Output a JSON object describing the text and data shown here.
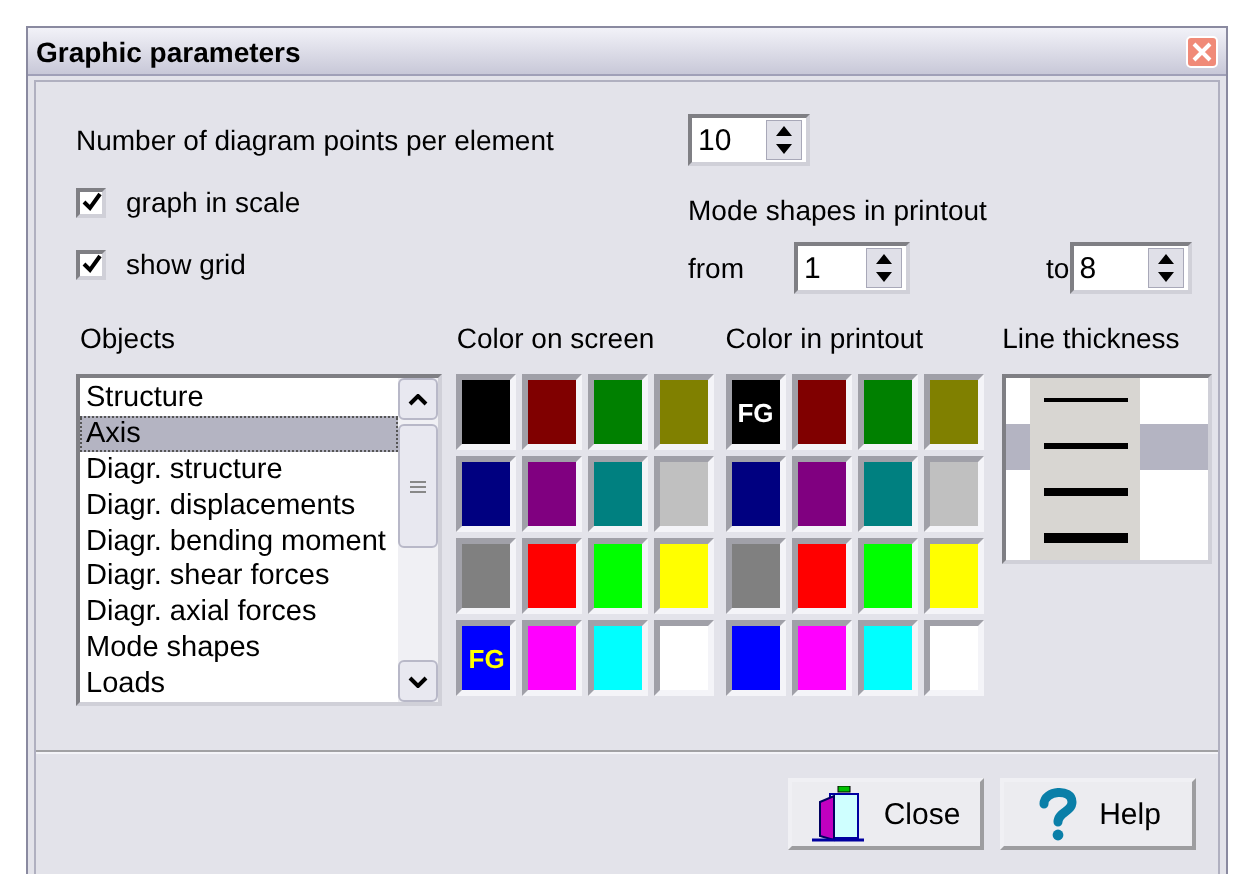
{
  "window": {
    "title": "Graphic parameters"
  },
  "points": {
    "label": "Number of diagram points per element",
    "value": "10"
  },
  "checkboxes": [
    {
      "label": "graph in scale",
      "checked": true
    },
    {
      "label": "show grid",
      "checked": true
    }
  ],
  "mode_shapes": {
    "label": "Mode shapes in printout",
    "from_label": "from",
    "from_value": "1",
    "to_label": "to",
    "to_value": "8"
  },
  "objects": {
    "label": "Objects",
    "items": [
      {
        "label": "Structure",
        "selected": false
      },
      {
        "label": "Axis",
        "selected": true
      },
      {
        "label": "Diagr. structure",
        "selected": false
      },
      {
        "label": "Diagr. displacements",
        "selected": false
      },
      {
        "label": "Diagr. bending moment",
        "selected": false
      },
      {
        "label": "Diagr. shear forces",
        "selected": false
      },
      {
        "label": "Diagr. axial forces",
        "selected": false
      },
      {
        "label": "Mode shapes",
        "selected": false
      },
      {
        "label": "Loads",
        "selected": false
      }
    ]
  },
  "palettes": [
    {
      "kind": "screen",
      "label": "Color on screen",
      "fg_label": "FG",
      "swatches": [
        {
          "color": "#000000",
          "selected": false
        },
        {
          "color": "#800000",
          "selected": false
        },
        {
          "color": "#008000",
          "selected": false
        },
        {
          "color": "#808000",
          "selected": false
        },
        {
          "color": "#000080",
          "selected": false
        },
        {
          "color": "#800080",
          "selected": false
        },
        {
          "color": "#008080",
          "selected": false
        },
        {
          "color": "#c0c0c0",
          "selected": false
        },
        {
          "color": "#808080",
          "selected": false
        },
        {
          "color": "#ff0000",
          "selected": false
        },
        {
          "color": "#00ff00",
          "selected": false
        },
        {
          "color": "#ffff00",
          "selected": false
        },
        {
          "color": "#0000ff",
          "selected": true
        },
        {
          "color": "#ff00ff",
          "selected": false
        },
        {
          "color": "#00ffff",
          "selected": false
        },
        {
          "color": "#ffffff",
          "selected": false
        }
      ]
    },
    {
      "kind": "printout",
      "label": "Color in printout",
      "fg_label": "FG",
      "swatches": [
        {
          "color": "#000000",
          "selected": true
        },
        {
          "color": "#800000",
          "selected": false
        },
        {
          "color": "#008000",
          "selected": false
        },
        {
          "color": "#808000",
          "selected": false
        },
        {
          "color": "#000080",
          "selected": false
        },
        {
          "color": "#800080",
          "selected": false
        },
        {
          "color": "#008080",
          "selected": false
        },
        {
          "color": "#c0c0c0",
          "selected": false
        },
        {
          "color": "#808080",
          "selected": false
        },
        {
          "color": "#ff0000",
          "selected": false
        },
        {
          "color": "#00ff00",
          "selected": false
        },
        {
          "color": "#ffff00",
          "selected": false
        },
        {
          "color": "#0000ff",
          "selected": false
        },
        {
          "color": "#ff00ff",
          "selected": false
        },
        {
          "color": "#00ffff",
          "selected": false
        },
        {
          "color": "#ffffff",
          "selected": false
        }
      ]
    }
  ],
  "line_thickness": {
    "label": "Line thickness",
    "items": [
      {
        "selected": false
      },
      {
        "selected": true
      },
      {
        "selected": false
      },
      {
        "selected": false
      }
    ]
  },
  "buttons": [
    {
      "kind": "close",
      "label": "Close"
    },
    {
      "kind": "help",
      "label": "Help"
    }
  ]
}
